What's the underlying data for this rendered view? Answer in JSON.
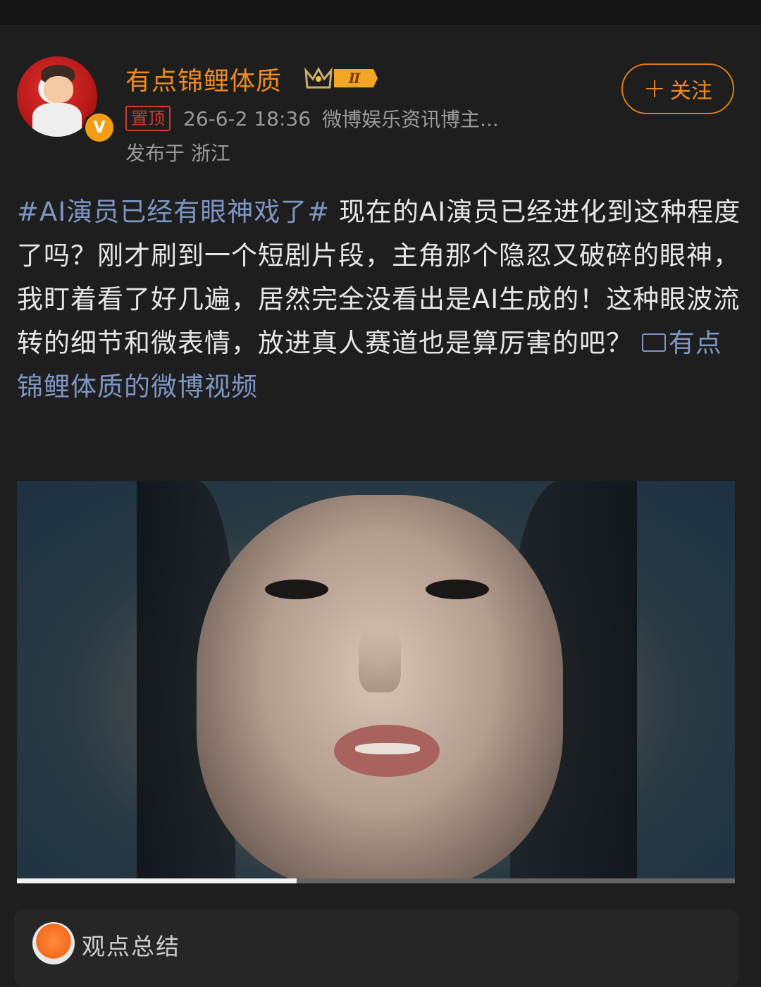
{
  "user": {
    "name": "有点锦鲤体质",
    "level_badge": "Ⅱ",
    "verified_badge": "V"
  },
  "meta": {
    "pinned_label": "置顶",
    "time": "26-6-2 18:36",
    "source": "微博娱乐资讯博主...",
    "location": "发布于 浙江"
  },
  "follow": {
    "label": "关注"
  },
  "post": {
    "hashtag": "#AI演员已经有眼神戏了#",
    "body": " 现在的AI演员已经进化到这种程度了吗？刚才刷到一个短剧片段，主角那个隐忍又破碎的眼神，我盯着看了好几遍，居然完全没看出是AI生成的！这种眼波流转的细节和微表情，放进真人赛道也是算厉害的吧？ ",
    "video_link": "有点锦鲤体质的微博视频"
  },
  "video": {
    "progress": 0.39
  },
  "summary": {
    "title": "观点总结"
  },
  "colors": {
    "accent": "#f08a24",
    "link": "#7d96c4",
    "pin": "#d33a2c",
    "background": "#1e1e1e"
  }
}
